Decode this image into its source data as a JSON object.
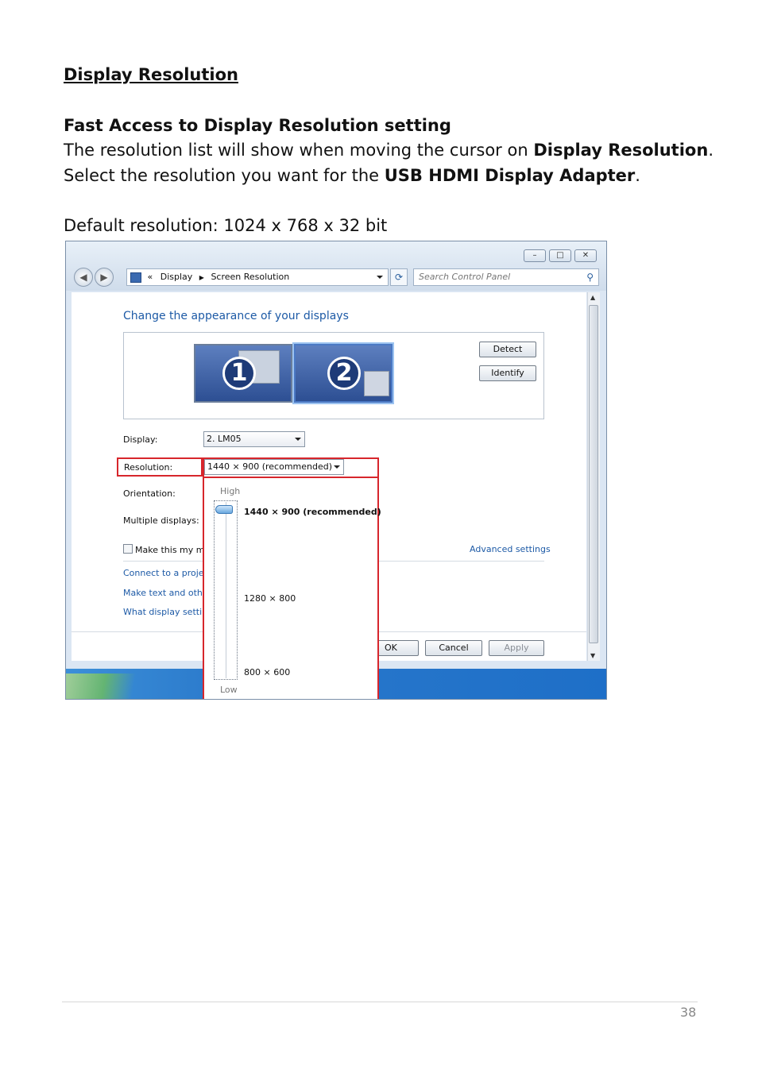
{
  "doc": {
    "heading": "Display Resolution",
    "subheading": "Fast Access to Display Resolution setting",
    "line1_a": "The resolution list will show when moving the cursor on ",
    "line1_b": "Display Resolution",
    "line1_c": ".",
    "line2_a": "Select the resolution you want for the ",
    "line2_b": "USB HDMI Display Adapter",
    "line2_c": ".",
    "default_line": "Default resolution: 1024 x 768 x 32 bit",
    "page_number": "38"
  },
  "window": {
    "breadcrumb_prefix": "«",
    "breadcrumb_1": "Display",
    "breadcrumb_2": "Screen Resolution",
    "search_placeholder": "Search Control Panel",
    "title": "Change the appearance of your displays",
    "monitor_1": "1",
    "monitor_2": "2",
    "detect_label": "Detect",
    "identify_label": "Identify",
    "display_label": "Display:",
    "display_value": "2. LM05",
    "resolution_label": "Resolution:",
    "resolution_value": "1440 × 900 (recommended)",
    "orientation_label": "Orientation:",
    "multiple_label": "Multiple displays:",
    "make_main_label": "Make this my m",
    "advanced_link": "Advanced settings",
    "link_projector": "Connect to a projec",
    "link_text_size": "Make text and othe",
    "link_what": "What display settin",
    "ok_label": "OK",
    "cancel_label": "Cancel",
    "apply_label": "Apply"
  },
  "resolution_popup": {
    "high_label": "High",
    "low_label": "Low",
    "options": [
      "1440 × 900 (recommended)",
      "1280 × 800",
      "800 × 600"
    ],
    "selected": "1440 × 900 (recommended)"
  },
  "colors": {
    "highlight": "#d7262c",
    "link": "#1d5aa6"
  }
}
